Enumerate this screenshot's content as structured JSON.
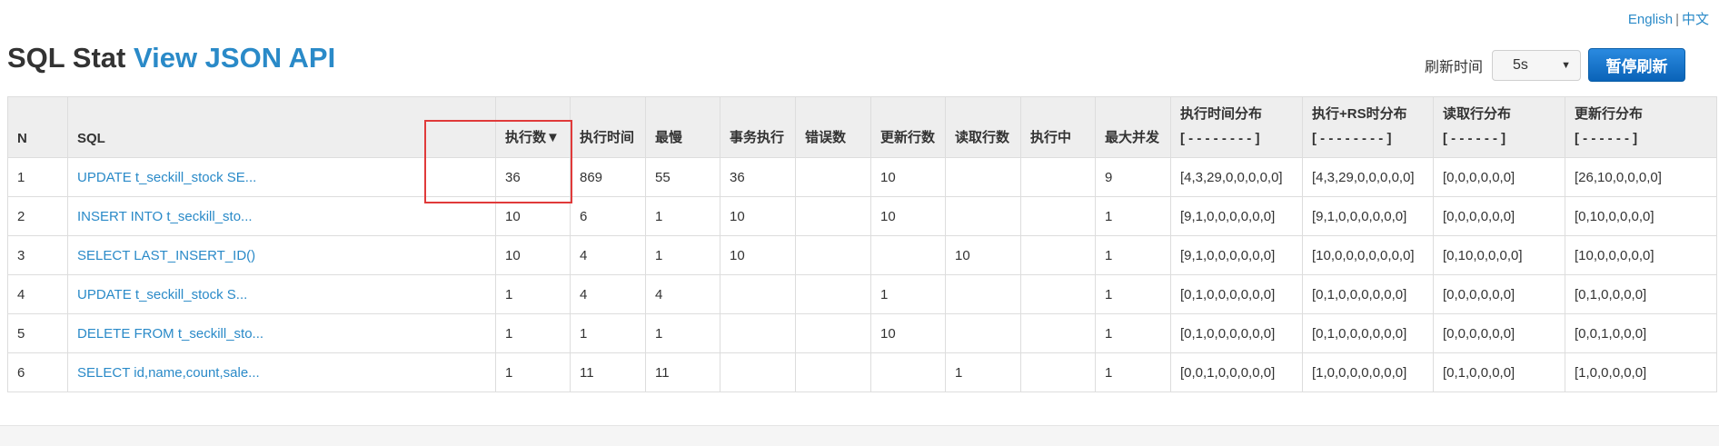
{
  "lang": {
    "english": "English",
    "separator": "|",
    "chinese": "中文"
  },
  "page": {
    "title_prefix": "SQL Stat",
    "title_link": "View JSON API"
  },
  "refresh": {
    "label": "刷新时间",
    "interval": "5s",
    "pause_button": "暂停刷新"
  },
  "table": {
    "headers": [
      {
        "l1": "N",
        "l2": ""
      },
      {
        "l1": "SQL",
        "l2": ""
      },
      {
        "l1": "执行数▼",
        "l2": ""
      },
      {
        "l1": "执行时间",
        "l2": ""
      },
      {
        "l1": "最慢",
        "l2": ""
      },
      {
        "l1": "事务执行",
        "l2": ""
      },
      {
        "l1": "错误数",
        "l2": ""
      },
      {
        "l1": "更新行数",
        "l2": ""
      },
      {
        "l1": "读取行数",
        "l2": ""
      },
      {
        "l1": "执行中",
        "l2": ""
      },
      {
        "l1": "最大并发",
        "l2": ""
      },
      {
        "l1": "执行时间分布",
        "l2": "[ - - - - - - - - ]"
      },
      {
        "l1": "执行+RS时分布",
        "l2": "[ - - - - - - - - ]"
      },
      {
        "l1": "读取行分布",
        "l2": "[ - - - - - - ]"
      },
      {
        "l1": "更新行分布",
        "l2": "[ - - - - - - ]"
      }
    ],
    "rows": [
      [
        "1",
        "UPDATE t_seckill_stock SE...",
        "36",
        "869",
        "55",
        "36",
        "",
        "10",
        "",
        "",
        "9",
        "[4,3,29,0,0,0,0,0]",
        "[4,3,29,0,0,0,0,0]",
        "[0,0,0,0,0,0]",
        "[26,10,0,0,0,0]"
      ],
      [
        "2",
        "INSERT INTO t_seckill_sto...",
        "10",
        "6",
        "1",
        "10",
        "",
        "10",
        "",
        "",
        "1",
        "[9,1,0,0,0,0,0,0]",
        "[9,1,0,0,0,0,0,0]",
        "[0,0,0,0,0,0]",
        "[0,10,0,0,0,0]"
      ],
      [
        "3",
        "SELECT LAST_INSERT_ID()",
        "10",
        "4",
        "1",
        "10",
        "",
        "",
        "10",
        "",
        "1",
        "[9,1,0,0,0,0,0,0]",
        "[10,0,0,0,0,0,0,0]",
        "[0,10,0,0,0,0]",
        "[10,0,0,0,0,0]"
      ],
      [
        "4",
        "UPDATE t_seckill_stock S...",
        "1",
        "4",
        "4",
        "",
        "",
        "1",
        "",
        "",
        "1",
        "[0,1,0,0,0,0,0,0]",
        "[0,1,0,0,0,0,0,0]",
        "[0,0,0,0,0,0]",
        "[0,1,0,0,0,0]"
      ],
      [
        "5",
        "DELETE FROM t_seckill_sto...",
        "1",
        "1",
        "1",
        "",
        "",
        "10",
        "",
        "",
        "1",
        "[0,1,0,0,0,0,0,0]",
        "[0,1,0,0,0,0,0,0]",
        "[0,0,0,0,0,0]",
        "[0,0,1,0,0,0]"
      ],
      [
        "6",
        "SELECT id,name,count,sale...",
        "1",
        "11",
        "11",
        "",
        "",
        "",
        "1",
        "",
        "1",
        "[0,0,1,0,0,0,0,0]",
        "[1,0,0,0,0,0,0,0]",
        "[0,1,0,0,0,0]",
        "[1,0,0,0,0,0]"
      ]
    ]
  }
}
